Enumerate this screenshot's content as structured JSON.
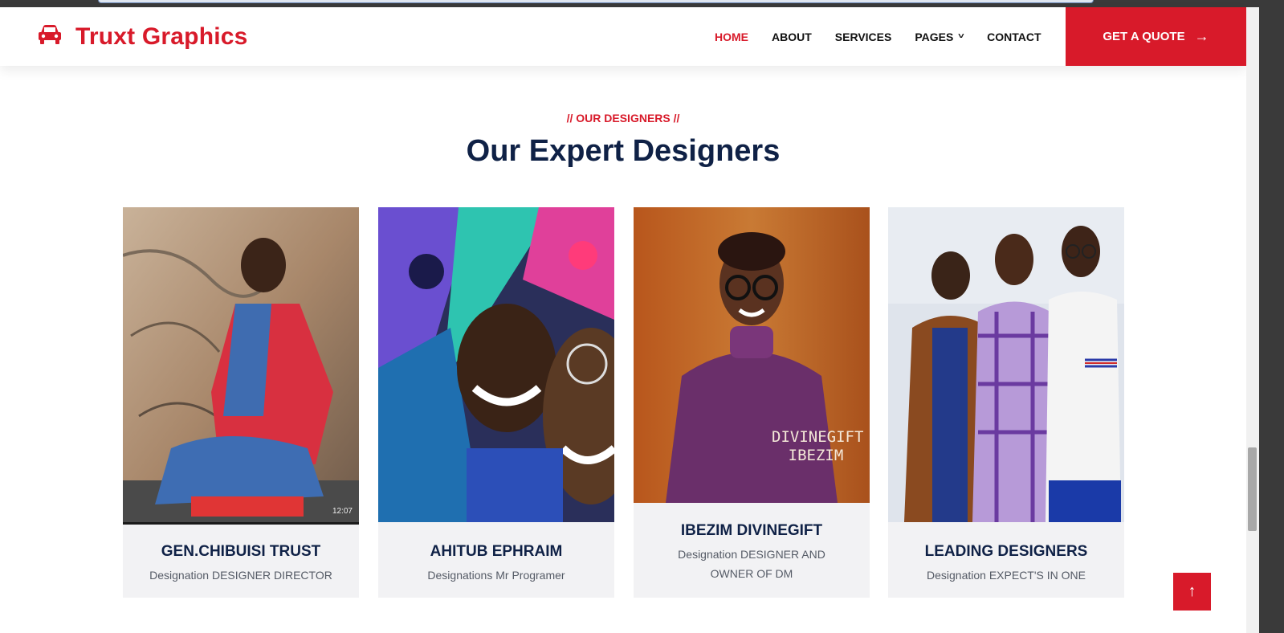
{
  "brand": {
    "name": "Truxt Graphics",
    "icon": "car-icon"
  },
  "nav": {
    "items": [
      {
        "label": "HOME",
        "active": true
      },
      {
        "label": "ABOUT",
        "active": false
      },
      {
        "label": "SERVICES",
        "active": false
      },
      {
        "label": "PAGES",
        "active": false,
        "dropdown": true
      },
      {
        "label": "CONTACT",
        "active": false
      }
    ],
    "cta": {
      "label": "GET A QUOTE",
      "icon": "arrow-right-icon"
    }
  },
  "section": {
    "subtitle": "// OUR DESIGNERS //",
    "title": "Our Expert Designers"
  },
  "designers": [
    {
      "name": "GEN.CHIBUISI TRUST",
      "designation": "Designation DESIGNER DIRECTOR",
      "photo_timestamp": "12:07"
    },
    {
      "name": "AHITUB EPHRAIM",
      "designation": "Designations Mr Programer"
    },
    {
      "name": "IBEZIM DIVINEGIFT",
      "designation": "Designation DESIGNER AND OWNER OF DM",
      "photo_watermark": "DIVINEGIFT IBEZIM"
    },
    {
      "name": "LEADING DESIGNERS",
      "designation": "Designation EXPECT'S IN ONE"
    }
  ],
  "back_to_top": {
    "icon": "arrow-up-icon"
  },
  "colors": {
    "accent": "#d81a2a",
    "heading": "#0f2146",
    "card_bg": "#f2f2f4"
  }
}
